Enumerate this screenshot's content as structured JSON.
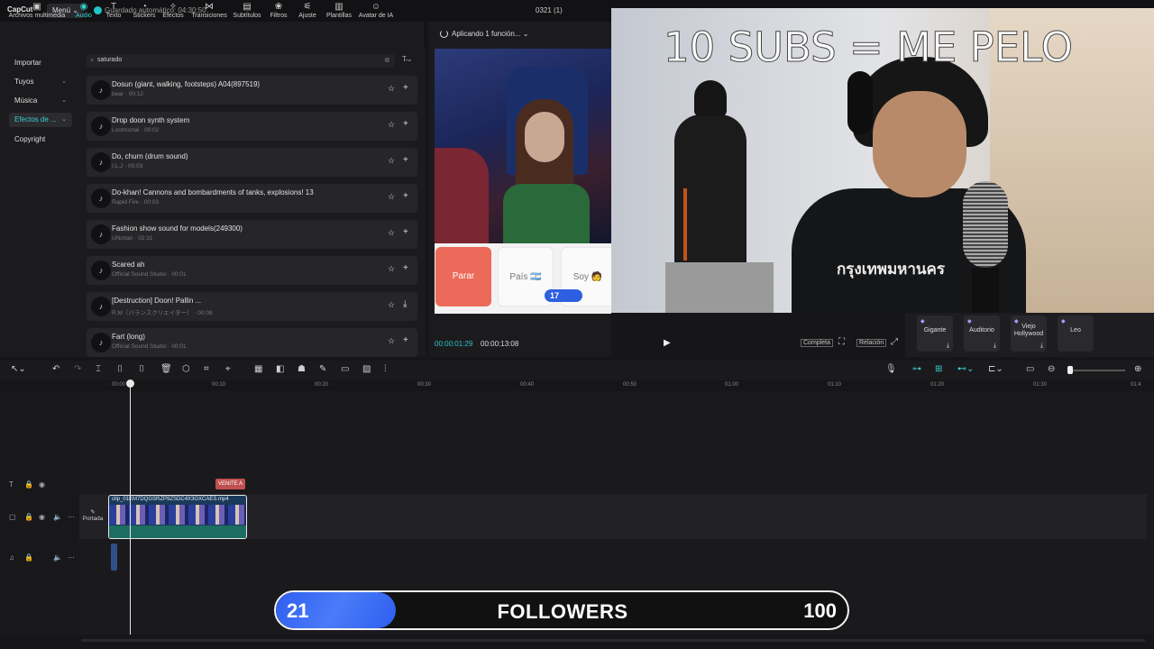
{
  "app": {
    "logo": "CapCut",
    "menu_label": "Menú ⌄",
    "autosave": "Guardado automático: 04:30:50",
    "project_title": "0321 (1)"
  },
  "tools": [
    {
      "label": "Archivos multimedia",
      "icon": "media-icon"
    },
    {
      "label": "Audio",
      "icon": "audio-icon"
    },
    {
      "label": "Texto",
      "icon": "text-icon"
    },
    {
      "label": "Stickers",
      "icon": "sticker-icon"
    },
    {
      "label": "Efectos",
      "icon": "effects-icon"
    },
    {
      "label": "Transiciones",
      "icon": "transitions-icon"
    },
    {
      "label": "Subtítulos",
      "icon": "subtitles-icon"
    },
    {
      "label": "Filtros",
      "icon": "filters-icon"
    },
    {
      "label": "Ajuste",
      "icon": "adjust-icon"
    },
    {
      "label": "Plantillas",
      "icon": "templates-icon"
    },
    {
      "label": "Avatar de IA",
      "icon": "avatar-icon"
    }
  ],
  "categories": [
    "Importar",
    "Tuyos",
    "Música",
    "Efectos de ...",
    "Copyright"
  ],
  "search": {
    "value": "saturado"
  },
  "sounds": [
    {
      "title": "Dosun (giant, walking, footsteps) A04(897519)",
      "meta": "bear · 00:12",
      "action": "+"
    },
    {
      "title": "Drop doon synth system",
      "meta": "Lostmortal · 00:02",
      "action": "+"
    },
    {
      "title": "Do, churn (drum sound)",
      "meta": "I.L.J · 00:03",
      "action": "+"
    },
    {
      "title": "Do-khan! Cannons and bombardments of tanks, explosions! 13",
      "meta": "Rapid Fire · 00:03",
      "action": "+"
    },
    {
      "title": "Fashion show sound for models(249300)",
      "meta": "UNchan · 02:31",
      "action": "+"
    },
    {
      "title": "Scared ah",
      "meta": "Official Sound Studio · 00:01",
      "action": "+"
    },
    {
      "title": "[Destruction] Doon! Pallin ...",
      "meta": "R.M（バランスクリエイター） · 00:08",
      "action": "⤓"
    },
    {
      "title": "Fart (long)",
      "meta": "Official Sound Studio · 00:01",
      "action": "+"
    }
  ],
  "player": {
    "status": "Aplicando 1 función... ⌄",
    "tiles": [
      "Parar",
      "País 🇦🇷",
      "Soy 🧑"
    ],
    "pill": "17",
    "current_time": "00:00:01:29",
    "duration": "00:00:13:08",
    "btn_completa": "Completa",
    "btn_relacion": "Relación"
  },
  "overlay": {
    "title": "10 SUBS = ME PELO",
    "shirt_text": "กรุงเทพมหานคร"
  },
  "voices": [
    "Gigante",
    "Auditorio",
    "Viejo Hollywood",
    "Leo"
  ],
  "ruler": [
    "00:00",
    "00:10",
    "00:20",
    "00:30",
    "00:40",
    "00:50",
    "01:00",
    "01:10",
    "01:20",
    "01:30",
    "01:4"
  ],
  "timeline": {
    "text_clip": "VENITE A",
    "video_clip": "clip_01KM7DQGSRZP9ZSDC4X3GXCAES.mp4",
    "cover_label": "Portada"
  },
  "followers": {
    "current": 21,
    "max": 100,
    "label": "FOLLOWERS",
    "current_text": "21",
    "max_text": "100"
  },
  "colors": {
    "accent": "#3ad0d0",
    "progress": "#2f5ef0",
    "text_clip": "#c05050",
    "tile_red": "#ec6a5a"
  }
}
